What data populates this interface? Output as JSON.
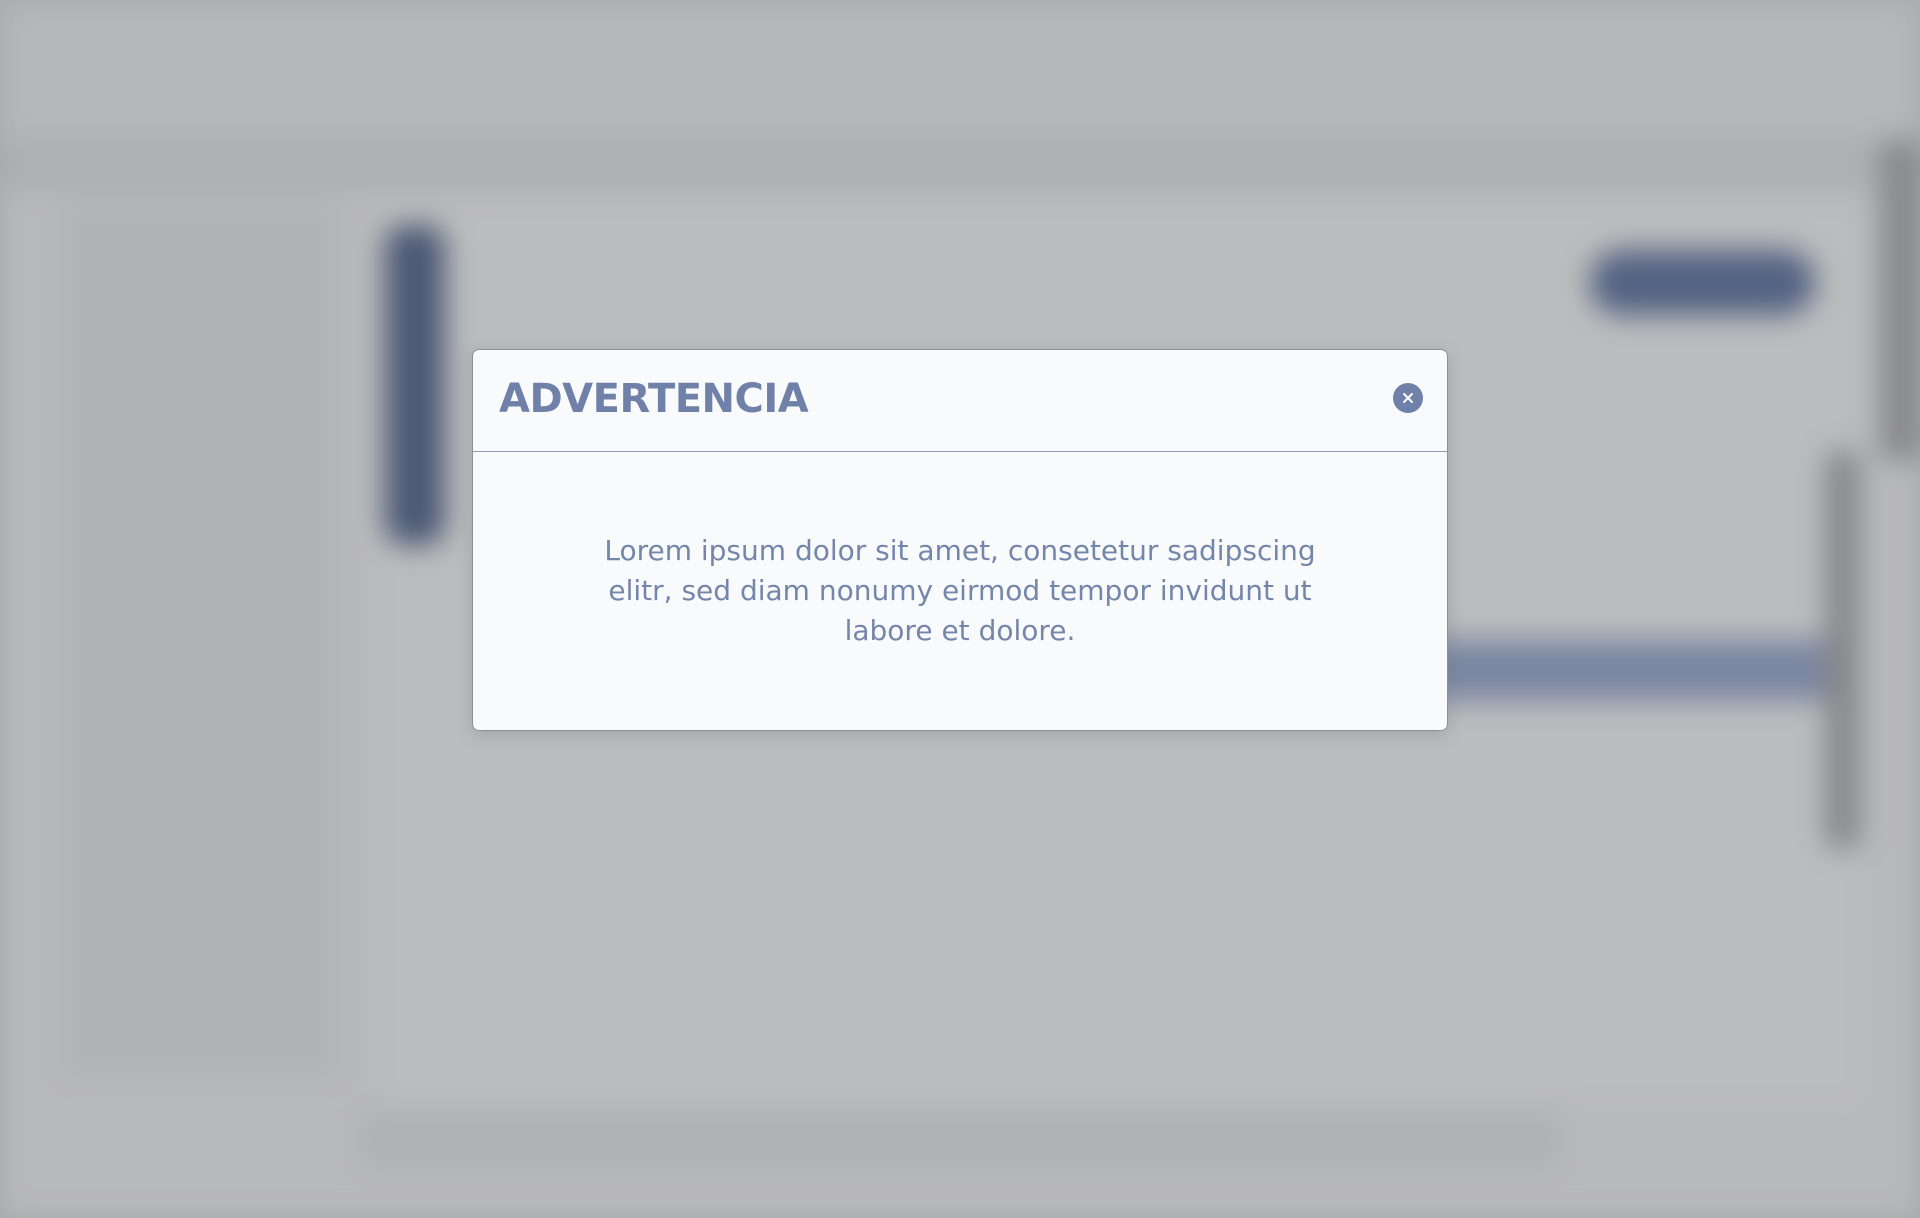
{
  "dialog": {
    "title": "ADVERTENCIA",
    "message": "Lorem ipsum dolor sit amet, consetetur sadipscing elitr, sed diam nonumy eirmod tempor invidunt ut labore et dolore.",
    "close_icon": "close-icon"
  },
  "colors": {
    "accent": "#6f81a8",
    "dialog_background": "#f9fafb",
    "backdrop": "#b9babb"
  }
}
